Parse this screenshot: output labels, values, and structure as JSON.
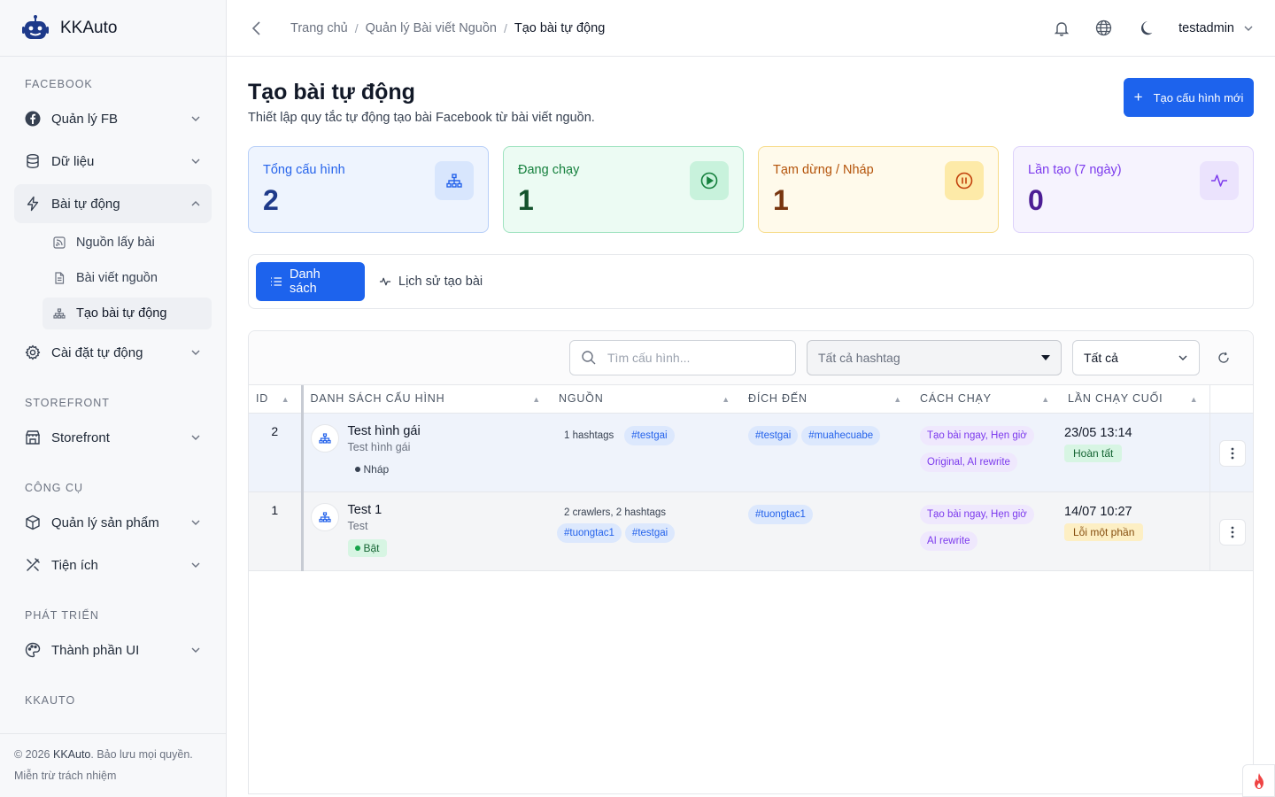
{
  "app": {
    "name": "KKAuto"
  },
  "sidebar": {
    "sections": {
      "facebook": "FACEBOOK",
      "storefront": "STOREFRONT",
      "tools": "CÔNG CỤ",
      "dev": "PHÁT TRIỂN",
      "kkauto": "KKAUTO"
    },
    "items": {
      "fb": "Quản lý FB",
      "data": "Dữ liệu",
      "auto_post": "Bài tự động",
      "sources": "Nguồn lấy bài",
      "source_posts": "Bài viết nguồn",
      "create_auto": "Tạo bài tự động",
      "auto_settings": "Cài đặt tự động",
      "storefront": "Storefront",
      "products": "Quản lý sản phẩm",
      "utilities": "Tiện ích",
      "ui_components": "Thành phần UI"
    },
    "footer": {
      "copyright_prefix": "© 2026",
      "brand": "KKAuto",
      "copyright_suffix": ". Bảo lưu mọi quyền.",
      "disclaimer": "Miễn trừ trách nhiệm"
    }
  },
  "topbar": {
    "breadcrumb": [
      "Trang chủ",
      "Quản lý Bài viết Nguồn",
      "Tạo bài tự động"
    ],
    "separator": "/",
    "user": "testadmin"
  },
  "page": {
    "title": "Tạo bài tự động",
    "subtitle": "Thiết lập quy tắc tự động tạo bài Facebook từ bài viết nguồn.",
    "new_button": "Tạo cấu hình mới"
  },
  "stats": [
    {
      "label": "Tổng cấu hình",
      "value": "2",
      "icon": "sitemap-icon",
      "color": "#2563eb"
    },
    {
      "label": "Đang chạy",
      "value": "1",
      "icon": "play-icon",
      "color": "#15803d"
    },
    {
      "label": "Tạm dừng / Nháp",
      "value": "1",
      "icon": "pause-icon",
      "color": "#c2410c"
    },
    {
      "label": "Lần tạo (7 ngày)",
      "value": "0",
      "icon": "activity-icon",
      "color": "#7c3aed"
    }
  ],
  "tabs": {
    "list": "Danh sách",
    "history": "Lịch sử tạo bài"
  },
  "filters": {
    "search_placeholder": "Tìm cấu hình...",
    "hashtag_select": "Tất cả hashtag",
    "status_select": "Tất cả"
  },
  "table": {
    "headers": {
      "id": "ID",
      "config": "DANH SÁCH CẤU HÌNH",
      "source": "NGUỒN",
      "target": "ĐÍCH ĐẾN",
      "run": "CÁCH CHẠY",
      "last_run": "LẦN CHẠY CUỐI"
    },
    "rows": [
      {
        "id": "2",
        "name": "Test hình gái",
        "desc": "Test hình gái",
        "status": "Nháp",
        "source_text": "1 hashtags",
        "source_tags": [
          "#testgai"
        ],
        "targets": [
          "#testgai",
          "#muahecuabe"
        ],
        "run_modes": [
          "Tạo bài ngay, Hẹn giờ",
          "Original, AI rewrite"
        ],
        "last_run": "23/05 13:14",
        "result": "Hoàn tất"
      },
      {
        "id": "1",
        "name": "Test 1",
        "desc": "Test",
        "status": "Bật",
        "source_text": "2 crawlers, 2 hashtags",
        "source_tags": [
          "#tuongtac1",
          "#testgai"
        ],
        "targets": [
          "#tuongtac1"
        ],
        "run_modes": [
          "Tạo bài ngay, Hẹn giờ",
          "AI rewrite"
        ],
        "last_run": "14/07 10:27",
        "result": "Lỗi một phần"
      }
    ]
  },
  "colors": {
    "primary": "#1d63ed"
  }
}
